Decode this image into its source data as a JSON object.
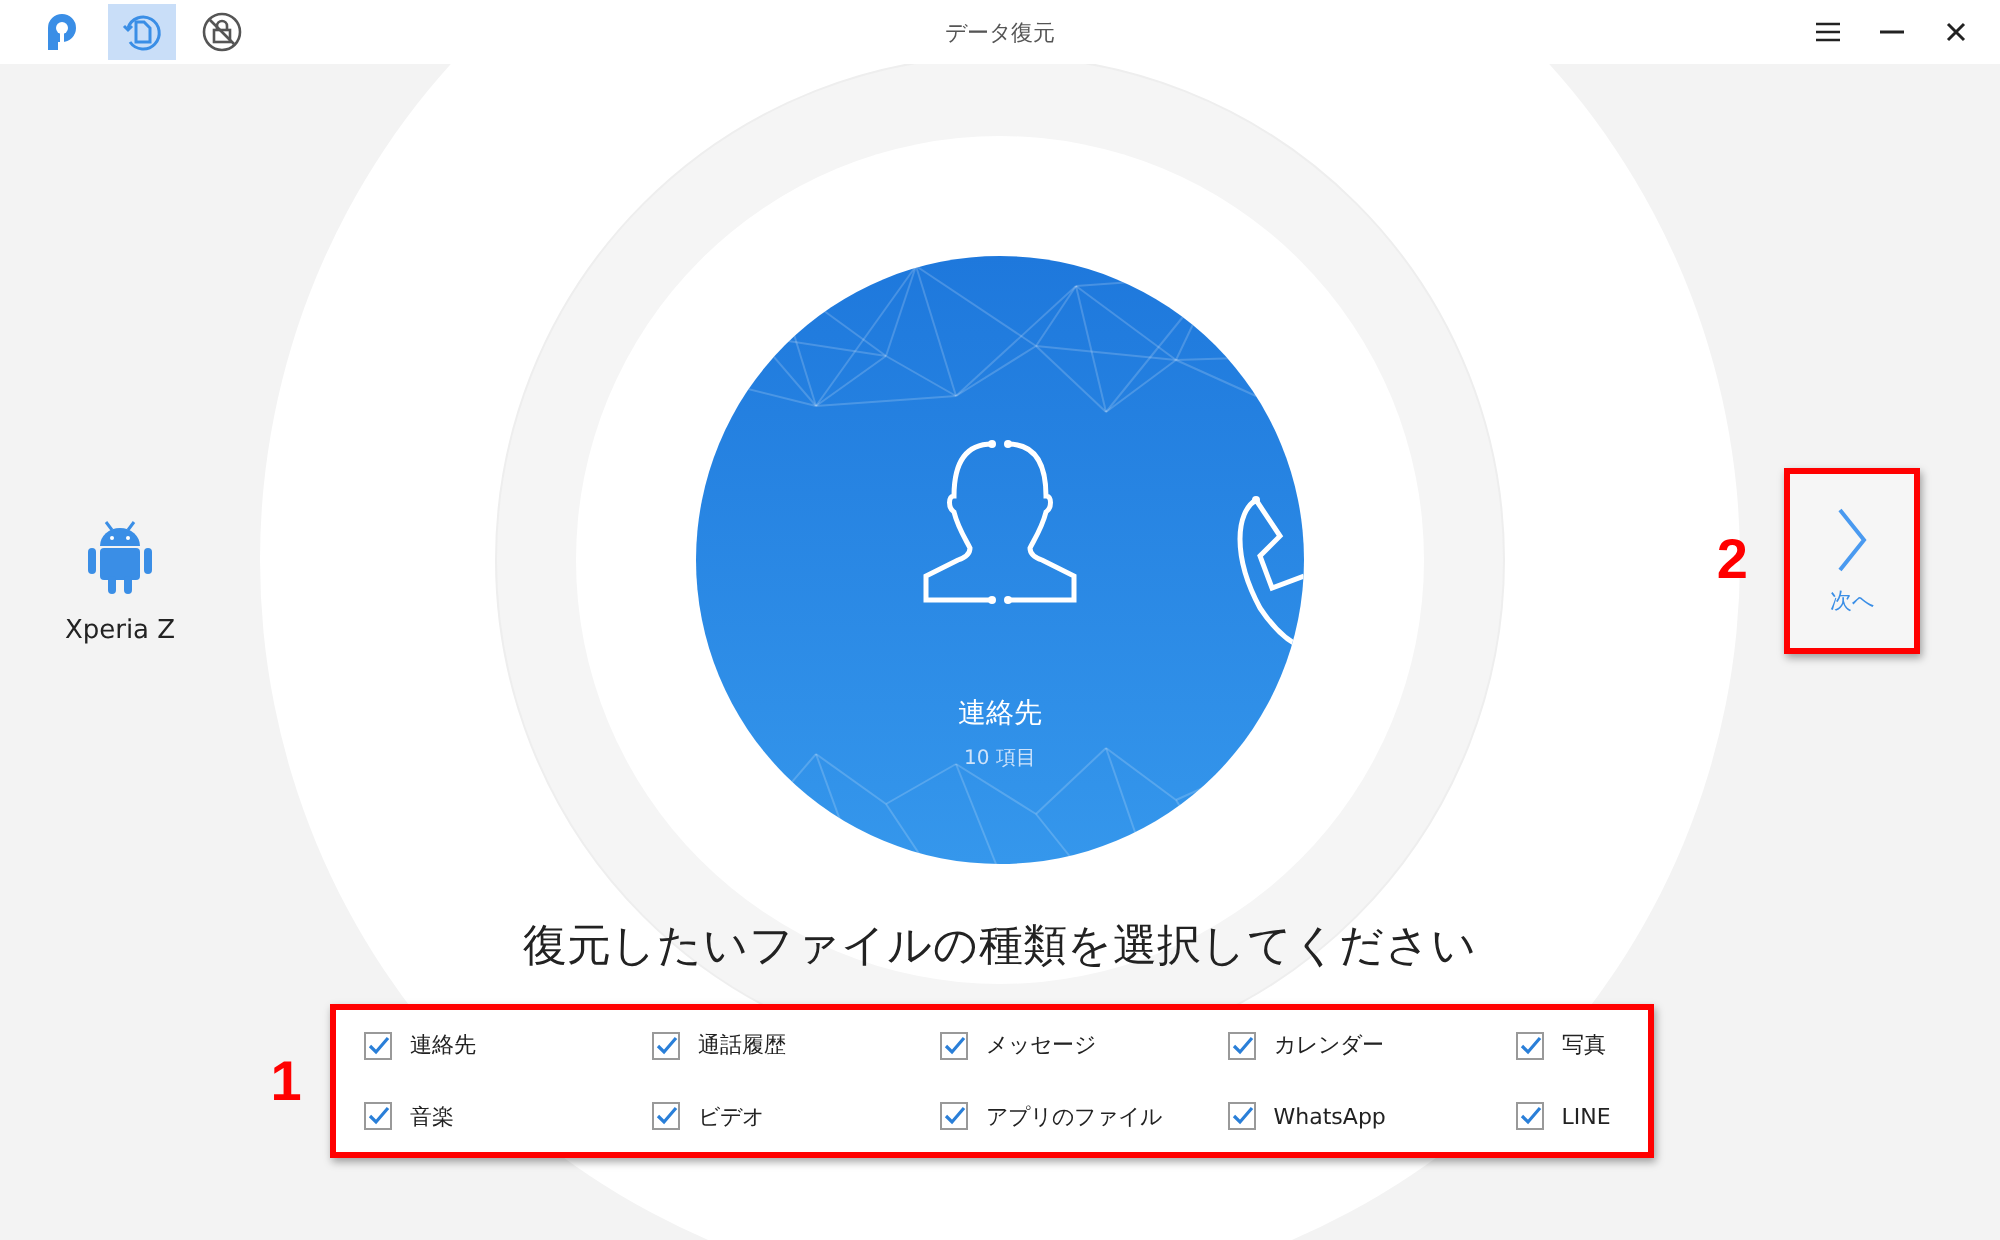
{
  "window": {
    "title": "データ復元"
  },
  "mode_tabs": [
    {
      "selected": true
    },
    {
      "selected": false
    }
  ],
  "device": {
    "name": "Xperia Z"
  },
  "carousel": {
    "label": "連絡先",
    "count": "10 項目"
  },
  "next_button": {
    "label": "次へ"
  },
  "heading": "復元したいファイルの種類を選択してください",
  "file_types": [
    {
      "label": "連絡先",
      "checked": true
    },
    {
      "label": "通話履歴",
      "checked": true
    },
    {
      "label": "メッセージ",
      "checked": true
    },
    {
      "label": "カレンダー",
      "checked": true
    },
    {
      "label": "写真",
      "checked": true
    },
    {
      "label": "音楽",
      "checked": true
    },
    {
      "label": "ビデオ",
      "checked": true
    },
    {
      "label": "アプリのファイル",
      "checked": true
    },
    {
      "label": "WhatsApp",
      "checked": true
    },
    {
      "label": "LINE",
      "checked": true
    }
  ],
  "annotations": [
    "1",
    "2"
  ]
}
